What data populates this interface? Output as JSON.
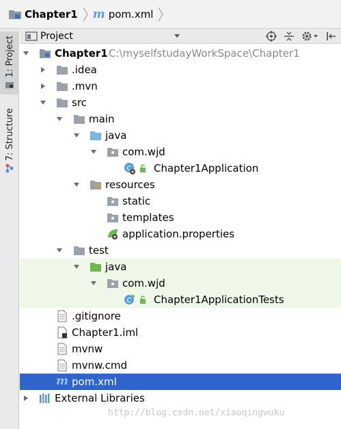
{
  "breadcrumb": {
    "items": [
      {
        "label": "Chapter1",
        "icon": "module-folder-icon"
      },
      {
        "label": "pom.xml",
        "icon": "maven-m-icon"
      }
    ]
  },
  "tool_stripe": {
    "tabs": [
      {
        "label": "1: Project",
        "icon": "project-icon"
      },
      {
        "label": "7: Structure",
        "icon": "structure-icon"
      }
    ]
  },
  "panel": {
    "title": "Project",
    "actions": [
      "locate-target-icon",
      "collapse-all-icon",
      "settings-gear-icon",
      "hide-panel-icon"
    ]
  },
  "tree": {
    "root": {
      "label": "Chapter1",
      "path": "C:\\myselfstudayWorkSpace\\Chapter1"
    },
    "nodes": [
      {
        "label": ".idea",
        "icon": "folder-icon",
        "state": "collapsed"
      },
      {
        "label": ".mvn",
        "icon": "folder-icon",
        "state": "collapsed"
      },
      {
        "label": "src",
        "icon": "folder-icon",
        "state": "expanded"
      },
      {
        "label": "main",
        "icon": "folder-icon",
        "state": "expanded"
      },
      {
        "label": "java",
        "icon": "source-root-folder-icon",
        "state": "expanded"
      },
      {
        "label": "com.wjd",
        "icon": "package-icon",
        "state": "expanded"
      },
      {
        "label": "Chapter1Application",
        "icon": "spring-boot-class-icon",
        "state": "leaf"
      },
      {
        "label": "resources",
        "icon": "resources-folder-icon",
        "state": "expanded"
      },
      {
        "label": "static",
        "icon": "package-icon",
        "state": "leaf"
      },
      {
        "label": "templates",
        "icon": "package-icon",
        "state": "leaf"
      },
      {
        "label": "application.properties",
        "icon": "spring-properties-icon",
        "state": "leaf"
      },
      {
        "label": "test",
        "icon": "folder-icon",
        "state": "expanded"
      },
      {
        "label": "java",
        "icon": "test-root-folder-icon",
        "state": "expanded"
      },
      {
        "label": "com.wjd",
        "icon": "package-icon",
        "state": "expanded"
      },
      {
        "label": "Chapter1ApplicationTests",
        "icon": "test-class-icon",
        "state": "leaf"
      },
      {
        "label": ".gitignore",
        "icon": "text-file-icon",
        "state": "leaf"
      },
      {
        "label": "Chapter1.iml",
        "icon": "iml-file-icon",
        "state": "leaf"
      },
      {
        "label": "mvnw",
        "icon": "text-file-icon",
        "state": "leaf"
      },
      {
        "label": "mvnw.cmd",
        "icon": "text-file-icon",
        "state": "leaf"
      },
      {
        "label": "pom.xml",
        "icon": "maven-m-icon",
        "state": "selected"
      },
      {
        "label": "External Libraries",
        "icon": "libraries-icon",
        "state": "collapsed"
      }
    ]
  },
  "watermark": "http://blog.csdn.net/xiaoqingwuku",
  "colors": {
    "selection": "#2f65ca",
    "test_background": "#eef7e8",
    "folder_grey": "#9aa3ab",
    "source_blue": "#7ab6e3",
    "test_green": "#6cb94d",
    "maven_blue": "#5aa0d8"
  }
}
